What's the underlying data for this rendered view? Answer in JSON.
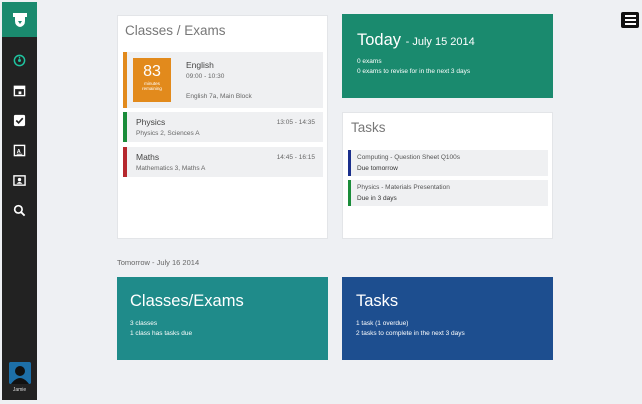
{
  "sidebar": {
    "logo_icon": "graduation-cap-icon",
    "items": [
      {
        "icon": "dashboard-icon"
      },
      {
        "icon": "calendar-icon"
      },
      {
        "icon": "checkbox-icon"
      },
      {
        "icon": "grades-icon"
      },
      {
        "icon": "contacts-icon"
      },
      {
        "icon": "search-icon"
      }
    ],
    "user_name": "Jamie"
  },
  "classes_exams": {
    "title": "Classes / Exams",
    "current": {
      "countdown_value": "83",
      "countdown_label_1": "minutes",
      "countdown_label_2": "remaining",
      "name": "English",
      "time": "09:00 - 10:30",
      "details": "English 7a, Main Block",
      "color": "#e28a1c"
    },
    "upcoming": [
      {
        "name": "Physics",
        "details": "Physics 2, Sciences A",
        "time": "13:05 - 14:35",
        "color": "#1a8c3a"
      },
      {
        "name": "Maths",
        "details": "Mathematics 3, Maths A",
        "time": "14:45 - 16:15",
        "color": "#b5272d"
      }
    ]
  },
  "today": {
    "title": "Today",
    "date": "- July 15 2014",
    "line1": "0 exams",
    "line2": "0 exams to revise for in the next 3 days",
    "color": "#1a8a6e"
  },
  "tasks": {
    "title": "Tasks",
    "items": [
      {
        "name": "Computing - Question Sheet Q100s",
        "due": "Due tomorrow",
        "color": "#1a2f8c"
      },
      {
        "name": "Physics - Materials Presentation",
        "due": "Due in 3 days",
        "color": "#1a8c3a"
      }
    ]
  },
  "tomorrow": {
    "label": "Tomorrow - July 16 2014",
    "classes": {
      "title": "Classes/Exams",
      "line1": "3 classes",
      "line2": "1 class has tasks due",
      "color": "#1f8b8a"
    },
    "tasks": {
      "title": "Tasks",
      "line1": "1 task (1 overdue)",
      "line2": "2 tasks to complete in the next 3 days",
      "color": "#1d4e8f"
    }
  }
}
